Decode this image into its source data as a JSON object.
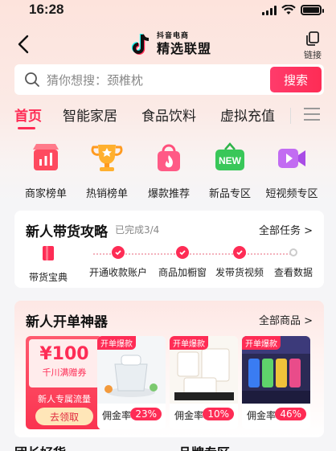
{
  "status": {
    "time": "16:28"
  },
  "header": {
    "brand_small": "抖音电商",
    "brand_big": "精选联盟",
    "link_label": "链接"
  },
  "search": {
    "placeholder": "猜你想搜：颈椎枕",
    "button": "搜索"
  },
  "tabs": [
    "首页",
    "智能家居",
    "食品饮料",
    "虚拟充值"
  ],
  "categories": [
    {
      "label": "商家榜单",
      "icon": "shop-ranking-icon"
    },
    {
      "label": "热销榜单",
      "icon": "trophy-icon"
    },
    {
      "label": "爆款推荐",
      "icon": "hot-bag-icon"
    },
    {
      "label": "新品专区",
      "icon": "new-icon"
    },
    {
      "label": "短视频专区",
      "icon": "video-icon"
    }
  ],
  "guide": {
    "title": "新人带货攻略",
    "progress": "已完成3/4",
    "more": "全部任务 >",
    "handbook": "带货宝典",
    "steps": [
      {
        "label": "开通收款账户",
        "done": true
      },
      {
        "label": "商品加橱窗",
        "done": true
      },
      {
        "label": "发带货视频",
        "done": true
      },
      {
        "label": "查看数据",
        "done": false
      }
    ]
  },
  "newbie": {
    "title": "新人开单神器",
    "more": "全部商品 >",
    "coupon": {
      "amount": "¥100",
      "condition": "千川满赠券",
      "desc": "新人专属流量",
      "button": "去领取"
    },
    "products": [
      {
        "tag": "开单爆款",
        "rate_label": "佣金率",
        "rate": "23%"
      },
      {
        "tag": "开单爆款",
        "rate_label": "佣金率",
        "rate": "10%"
      },
      {
        "tag": "开单爆款",
        "rate_label": "佣金率",
        "rate": "46%"
      }
    ]
  },
  "bottom": {
    "left": "团长好货",
    "right": "品牌专区"
  }
}
